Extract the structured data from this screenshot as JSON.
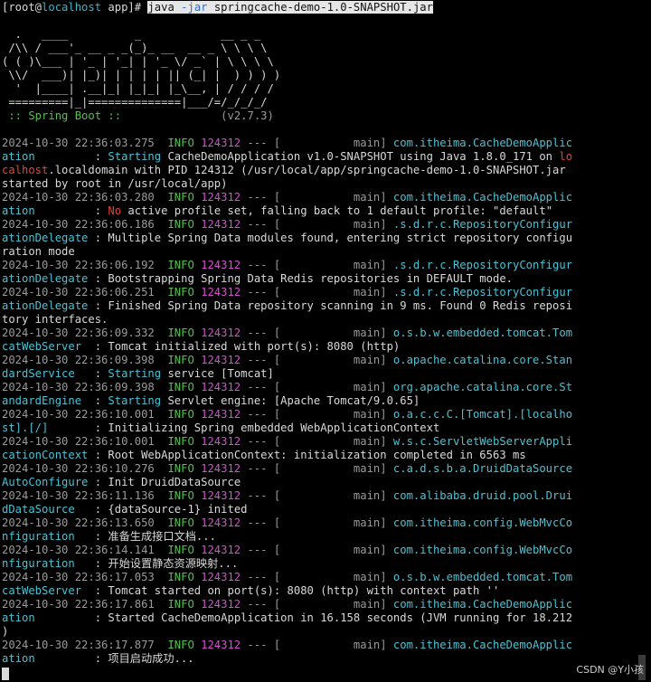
{
  "terminal": {
    "lines": [
      [
        {
          "t": "[root@",
          "c": "c-norm"
        },
        {
          "t": "localhost",
          "c": "c-cyan"
        },
        {
          "t": " app]# ",
          "c": "c-norm"
        },
        {
          "t": "java ",
          "c": "cmd-hl"
        },
        {
          "t": "-jar",
          "c": "cmd-blue"
        },
        {
          "t": " springcache-demo-1.0-SNAPSHOT.jar",
          "c": "cmd-hl"
        }
      ],
      [
        {
          "t": "",
          "c": "c-norm"
        }
      ],
      [
        {
          "t": "  .   ____          _            __ _ _",
          "c": "c-norm"
        }
      ],
      [
        {
          "t": " /\\\\ / ___'_ __ _ _(_)_ __  __ _ \\ \\ \\ \\",
          "c": "c-norm"
        }
      ],
      [
        {
          "t": "( ( )\\___ | '_ | '_| | '_ \\/ _` | \\ \\ \\ \\",
          "c": "c-norm"
        }
      ],
      [
        {
          "t": " \\\\/  ___)| |_)| | | | | || (_| |  ) ) ) )",
          "c": "c-norm"
        }
      ],
      [
        {
          "t": "  '  |____| .__|_| |_|_| |_\\__, | / / / /",
          "c": "c-norm"
        }
      ],
      [
        {
          "t": " =========|_|==============|___/=/_/_/_/",
          "c": "c-norm"
        }
      ],
      [
        {
          "t": " :: Spring Boot :: ",
          "c": "c-green"
        },
        {
          "t": "              (v2.7.3)",
          "c": "c-dim"
        }
      ],
      [
        {
          "t": "",
          "c": "c-norm"
        }
      ],
      [
        {
          "t": "2024-10-30 22:36:03.275  ",
          "c": "c-dim"
        },
        {
          "t": "INFO ",
          "c": "c-green"
        },
        {
          "t": "124312",
          "c": "c-mag"
        },
        {
          "t": " --- [           main] ",
          "c": "c-dim"
        },
        {
          "t": "com.itheima.CacheDemoApplic",
          "c": "c-cyanb"
        }
      ],
      [
        {
          "t": "ation        ",
          "c": "c-cyanb"
        },
        {
          "t": " : ",
          "c": "c-norm"
        },
        {
          "t": "Starting",
          "c": "c-cyanb"
        },
        {
          "t": " CacheDemoApplication v1.0-SNAPSHOT using Java 1.8.0_171 on ",
          "c": "c-norm"
        },
        {
          "t": "lo",
          "c": "c-red"
        }
      ],
      [
        {
          "t": "calhost",
          "c": "c-red"
        },
        {
          "t": ".localdomain with PID 124312 (/usr/local/app/springcache-demo-1.0-SNAPSHOT.jar",
          "c": "c-norm"
        }
      ],
      [
        {
          "t": "started by root in /usr/local/app)",
          "c": "c-norm"
        }
      ],
      [
        {
          "t": "2024-10-30 22:36:03.280  ",
          "c": "c-dim"
        },
        {
          "t": "INFO ",
          "c": "c-green"
        },
        {
          "t": "124312",
          "c": "c-mag"
        },
        {
          "t": " --- [           main] ",
          "c": "c-dim"
        },
        {
          "t": "com.itheima.CacheDemoApplic",
          "c": "c-cyanb"
        }
      ],
      [
        {
          "t": "ation        ",
          "c": "c-cyanb"
        },
        {
          "t": " : ",
          "c": "c-norm"
        },
        {
          "t": "No",
          "c": "c-red"
        },
        {
          "t": " active profile set, falling back to 1 default profile: \"default\"",
          "c": "c-norm"
        }
      ],
      [
        {
          "t": "2024-10-30 22:36:06.186  ",
          "c": "c-dim"
        },
        {
          "t": "INFO ",
          "c": "c-green"
        },
        {
          "t": "124312",
          "c": "c-mag"
        },
        {
          "t": " --- [           main] ",
          "c": "c-dim"
        },
        {
          "t": ".s.d.r.c.RepositoryConfigur",
          "c": "c-cyanb"
        }
      ],
      [
        {
          "t": "ationDelegate",
          "c": "c-cyanb"
        },
        {
          "t": " : Multiple Spring Data modules found, entering strict repository configu",
          "c": "c-norm"
        }
      ],
      [
        {
          "t": "ration mode",
          "c": "c-norm"
        }
      ],
      [
        {
          "t": "2024-10-30 22:36:06.192  ",
          "c": "c-dim"
        },
        {
          "t": "INFO ",
          "c": "c-green"
        },
        {
          "t": "124312",
          "c": "c-mag"
        },
        {
          "t": " --- [           main] ",
          "c": "c-dim"
        },
        {
          "t": ".s.d.r.c.RepositoryConfigur",
          "c": "c-cyanb"
        }
      ],
      [
        {
          "t": "ationDelegate",
          "c": "c-cyanb"
        },
        {
          "t": " : Bootstrapping Spring Data Redis repositories in DEFAULT mode.",
          "c": "c-norm"
        }
      ],
      [
        {
          "t": "2024-10-30 22:36:06.251  ",
          "c": "c-dim"
        },
        {
          "t": "INFO ",
          "c": "c-green"
        },
        {
          "t": "124312",
          "c": "c-mag"
        },
        {
          "t": " --- [           main] ",
          "c": "c-dim"
        },
        {
          "t": ".s.d.r.c.RepositoryConfigur",
          "c": "c-cyanb"
        }
      ],
      [
        {
          "t": "ationDelegate",
          "c": "c-cyanb"
        },
        {
          "t": " : Finished Spring Data repository scanning in 9 ms. Found 0 Redis reposi",
          "c": "c-norm"
        }
      ],
      [
        {
          "t": "tory interfaces.",
          "c": "c-norm"
        }
      ],
      [
        {
          "t": "2024-10-30 22:36:09.332  ",
          "c": "c-dim"
        },
        {
          "t": "INFO ",
          "c": "c-green"
        },
        {
          "t": "124312",
          "c": "c-mag"
        },
        {
          "t": " --- [           main] ",
          "c": "c-dim"
        },
        {
          "t": "o.s.b.w.embedded.tomcat.Tom",
          "c": "c-cyanb"
        }
      ],
      [
        {
          "t": "catWebServer ",
          "c": "c-cyanb"
        },
        {
          "t": " : Tomcat initialized with port(s): 8080 (http)",
          "c": "c-norm"
        }
      ],
      [
        {
          "t": "2024-10-30 22:36:09.398  ",
          "c": "c-dim"
        },
        {
          "t": "INFO ",
          "c": "c-green"
        },
        {
          "t": "124312",
          "c": "c-mag"
        },
        {
          "t": " --- [           main] ",
          "c": "c-dim"
        },
        {
          "t": "o.apache.catalina.core.Stan",
          "c": "c-cyanb"
        }
      ],
      [
        {
          "t": "dardService  ",
          "c": "c-cyanb"
        },
        {
          "t": " : ",
          "c": "c-norm"
        },
        {
          "t": "Starting",
          "c": "c-cyanb"
        },
        {
          "t": " service [Tomcat]",
          "c": "c-norm"
        }
      ],
      [
        {
          "t": "2024-10-30 22:36:09.398  ",
          "c": "c-dim"
        },
        {
          "t": "INFO ",
          "c": "c-green"
        },
        {
          "t": "124312",
          "c": "c-mag"
        },
        {
          "t": " --- [           main] ",
          "c": "c-dim"
        },
        {
          "t": "org.apache.catalina.core.St",
          "c": "c-cyanb"
        }
      ],
      [
        {
          "t": "andardEngine ",
          "c": "c-cyanb"
        },
        {
          "t": " : ",
          "c": "c-norm"
        },
        {
          "t": "Starting",
          "c": "c-cyanb"
        },
        {
          "t": " Servlet engine: [Apache Tomcat/9.0.65]",
          "c": "c-norm"
        }
      ],
      [
        {
          "t": "2024-10-30 22:36:10.001  ",
          "c": "c-dim"
        },
        {
          "t": "INFO ",
          "c": "c-green"
        },
        {
          "t": "124312",
          "c": "c-mag"
        },
        {
          "t": " --- [           main] ",
          "c": "c-dim"
        },
        {
          "t": "o.a.c.c.C.[Tomcat].[localho",
          "c": "c-cyanb"
        }
      ],
      [
        {
          "t": "st].[/]      ",
          "c": "c-cyanb"
        },
        {
          "t": " : Initializing Spring embedded WebApplicationContext",
          "c": "c-norm"
        }
      ],
      [
        {
          "t": "2024-10-30 22:36:10.001  ",
          "c": "c-dim"
        },
        {
          "t": "INFO ",
          "c": "c-green"
        },
        {
          "t": "124312",
          "c": "c-mag"
        },
        {
          "t": " --- [           main] ",
          "c": "c-dim"
        },
        {
          "t": "w.s.c.ServletWebServerAppli",
          "c": "c-cyanb"
        }
      ],
      [
        {
          "t": "cationContext",
          "c": "c-cyanb"
        },
        {
          "t": " : Root WebApplicationContext: initialization completed in 6563 ms",
          "c": "c-norm"
        }
      ],
      [
        {
          "t": "2024-10-30 22:36:10.276  ",
          "c": "c-dim"
        },
        {
          "t": "INFO ",
          "c": "c-green"
        },
        {
          "t": "124312",
          "c": "c-mag"
        },
        {
          "t": " --- [           main] ",
          "c": "c-dim"
        },
        {
          "t": "c.a.d.s.b.a.DruidDataSource",
          "c": "c-cyanb"
        }
      ],
      [
        {
          "t": "AutoConfigure",
          "c": "c-cyanb"
        },
        {
          "t": " : Init DruidDataSource",
          "c": "c-norm"
        }
      ],
      [
        {
          "t": "2024-10-30 22:36:11.136  ",
          "c": "c-dim"
        },
        {
          "t": "INFO ",
          "c": "c-green"
        },
        {
          "t": "124312",
          "c": "c-mag"
        },
        {
          "t": " --- [           main] ",
          "c": "c-dim"
        },
        {
          "t": "com.alibaba.druid.pool.Drui",
          "c": "c-cyanb"
        }
      ],
      [
        {
          "t": "dDataSource  ",
          "c": "c-cyanb"
        },
        {
          "t": " : {dataSource-1} inited",
          "c": "c-norm"
        }
      ],
      [
        {
          "t": "2024-10-30 22:36:13.650  ",
          "c": "c-dim"
        },
        {
          "t": "INFO ",
          "c": "c-green"
        },
        {
          "t": "124312",
          "c": "c-mag"
        },
        {
          "t": " --- [           main] ",
          "c": "c-dim"
        },
        {
          "t": "com.itheima.config.WebMvcCo",
          "c": "c-cyanb"
        }
      ],
      [
        {
          "t": "nfiguration  ",
          "c": "c-cyanb"
        },
        {
          "t": " : 准备生成接口文档...",
          "c": "c-norm"
        }
      ],
      [
        {
          "t": "2024-10-30 22:36:14.141  ",
          "c": "c-dim"
        },
        {
          "t": "INFO ",
          "c": "c-green"
        },
        {
          "t": "124312",
          "c": "c-mag"
        },
        {
          "t": " --- [           main] ",
          "c": "c-dim"
        },
        {
          "t": "com.itheima.config.WebMvcCo",
          "c": "c-cyanb"
        }
      ],
      [
        {
          "t": "nfiguration  ",
          "c": "c-cyanb"
        },
        {
          "t": " : 开始设置静态资源映射...",
          "c": "c-norm"
        }
      ],
      [
        {
          "t": "2024-10-30 22:36:17.053  ",
          "c": "c-dim"
        },
        {
          "t": "INFO ",
          "c": "c-green"
        },
        {
          "t": "124312",
          "c": "c-mag"
        },
        {
          "t": " --- [           main] ",
          "c": "c-dim"
        },
        {
          "t": "o.s.b.w.embedded.tomcat.Tom",
          "c": "c-cyanb"
        }
      ],
      [
        {
          "t": "catWebServer ",
          "c": "c-cyanb"
        },
        {
          "t": " : Tomcat started on port(s): 8080 (http) with context path ''",
          "c": "c-norm"
        }
      ],
      [
        {
          "t": "2024-10-30 22:36:17.861  ",
          "c": "c-dim"
        },
        {
          "t": "INFO ",
          "c": "c-green"
        },
        {
          "t": "124312",
          "c": "c-mag"
        },
        {
          "t": " --- [           main] ",
          "c": "c-dim"
        },
        {
          "t": "com.itheima.CacheDemoApplic",
          "c": "c-cyanb"
        }
      ],
      [
        {
          "t": "ation        ",
          "c": "c-cyanb"
        },
        {
          "t": " : Started CacheDemoApplication in 16.158 seconds (JVM running for 18.212",
          "c": "c-norm"
        }
      ],
      [
        {
          "t": ")",
          "c": "c-norm"
        }
      ],
      [
        {
          "t": "2024-10-30 22:36:17.877  ",
          "c": "c-dim"
        },
        {
          "t": "INFO ",
          "c": "c-green"
        },
        {
          "t": "124312",
          "c": "c-mag"
        },
        {
          "t": " --- [           main] ",
          "c": "c-dim"
        },
        {
          "t": "com.itheima.CacheDemoApplic",
          "c": "c-cyanb"
        }
      ],
      [
        {
          "t": "ation        ",
          "c": "c-cyanb"
        },
        {
          "t": " : 项目启动成功...",
          "c": "c-norm"
        }
      ]
    ]
  },
  "watermark": "CSDN @Y小孩"
}
